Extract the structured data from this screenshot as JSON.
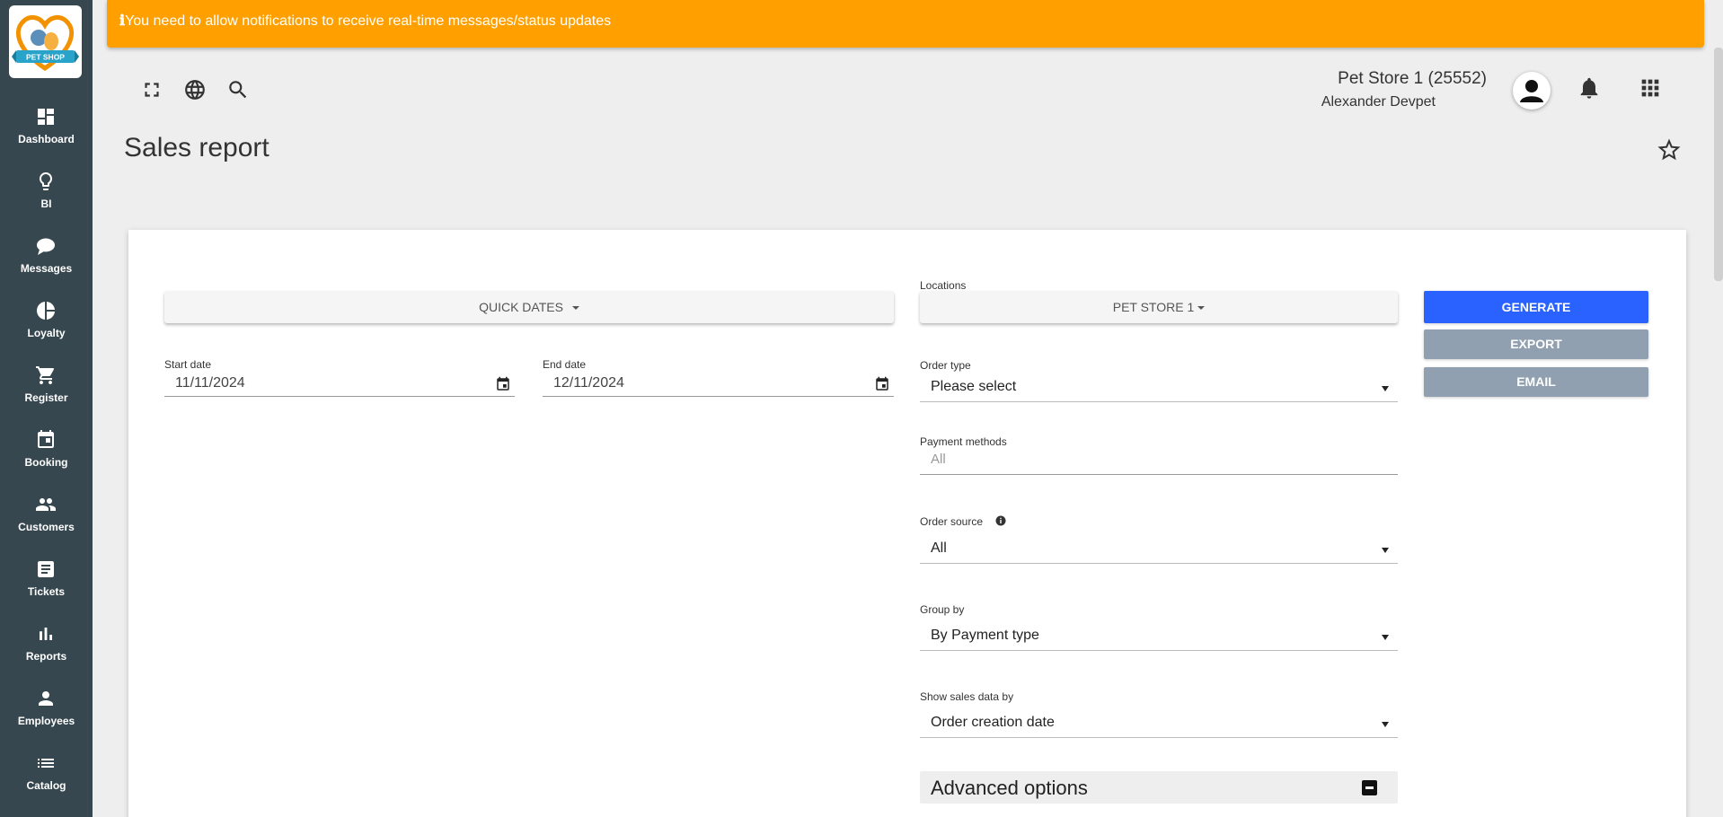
{
  "app": {
    "logo_text": "PET SHOP"
  },
  "banner": {
    "info_glyph": "ℹ",
    "message": "You need to allow notifications to receive real-time messages/status updates",
    "color": "#ffa000"
  },
  "sidebar": {
    "color": "#37474f",
    "items": [
      {
        "label": "Dashboard",
        "icon": "dashboard-icon"
      },
      {
        "label": "BI",
        "icon": "lightbulb-icon"
      },
      {
        "label": "Messages",
        "icon": "chat-bubble-icon"
      },
      {
        "label": "Loyalty",
        "icon": "pie-chart-icon"
      },
      {
        "label": "Register",
        "icon": "cart-icon"
      },
      {
        "label": "Booking",
        "icon": "calendar-icon"
      },
      {
        "label": "Customers",
        "icon": "people-icon"
      },
      {
        "label": "Tickets",
        "icon": "ticket-list-icon"
      },
      {
        "label": "Reports",
        "icon": "bar-chart-icon"
      },
      {
        "label": "Employees",
        "icon": "person-icon"
      },
      {
        "label": "Catalog",
        "icon": "list-icon"
      }
    ]
  },
  "header": {
    "store_name": "Pet Store 1 (25552)",
    "user_name": "Alexander Devpet",
    "icons": [
      "fullscreen-icon",
      "globe-icon",
      "search-icon",
      "avatar",
      "bell-icon",
      "apps-grid-icon"
    ]
  },
  "page": {
    "title": "Sales report",
    "favorite_icon": "star-outline-icon"
  },
  "filters": {
    "quick_dates_label": "QUICK DATES",
    "start_date_label": "Start date",
    "start_date_value": "11/11/2024",
    "end_date_label": "End date",
    "end_date_value": "12/11/2024",
    "locations_label": "Locations",
    "locations_value": "PET STORE 1",
    "order_type_label": "Order type",
    "order_type_value": "Please select",
    "payment_methods_label": "Payment methods",
    "payment_methods_placeholder": "All",
    "order_source_label": "Order source",
    "order_source_value": "All",
    "group_by_label": "Group by",
    "group_by_value": "By Payment type",
    "show_sales_by_label": "Show sales data by",
    "show_sales_by_value": "Order creation date",
    "advanced_options_label": "Advanced options"
  },
  "actions": {
    "generate_label": "GENERATE",
    "generate_color": "#2962ff",
    "export_label": "EXPORT",
    "email_label": "EMAIL",
    "secondary_color": "#90a0b0"
  }
}
